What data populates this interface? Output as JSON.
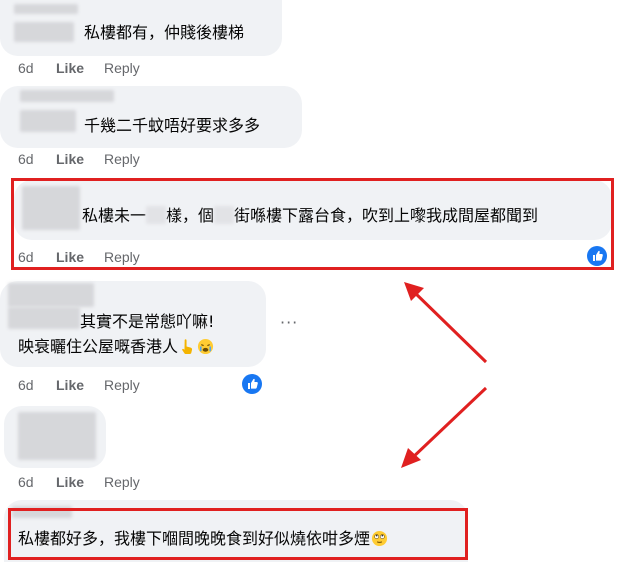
{
  "comments": [
    {
      "id": "c1",
      "lines": [
        "私樓都有，仲賤後樓梯"
      ],
      "time": "6d",
      "like_label": "Like",
      "reply_label": "Reply"
    },
    {
      "id": "c2",
      "lines": [
        "千幾二千蚊唔好要求多多"
      ],
      "time": "6d",
      "like_label": "Like",
      "reply_label": "Reply"
    },
    {
      "id": "c3",
      "text_parts": [
        "私樓未一",
        "樣，個",
        "街喺樓下露台食，吹到上嚟我成間屋都聞到"
      ],
      "time": "6d",
      "like_label": "Like",
      "reply_label": "Reply",
      "reaction": "like"
    },
    {
      "id": "c4",
      "lines": [
        "其實不是常態吖嘛!",
        "映衰曬住公屋嘅香港人"
      ],
      "line2_emojis": [
        "point-down-emoji",
        "crying-face-emoji"
      ],
      "time": "6d",
      "like_label": "Like",
      "reply_label": "Reply",
      "reaction": "like",
      "more_label": "···"
    },
    {
      "id": "c5",
      "lines": [],
      "time": "6d",
      "like_label": "Like",
      "reply_label": "Reply"
    },
    {
      "id": "c6",
      "lines": [
        "私樓都好多，我樓下嗰間晚晚食到好似燒依咁多煙"
      ],
      "emoji": "eye-roll-face-emoji"
    }
  ],
  "colors": {
    "bubble_bg": "#f0f2f5",
    "text": "#050505",
    "meta_text": "#65676b",
    "like_blue": "#1877f2",
    "annotation_red": "#e02020"
  }
}
